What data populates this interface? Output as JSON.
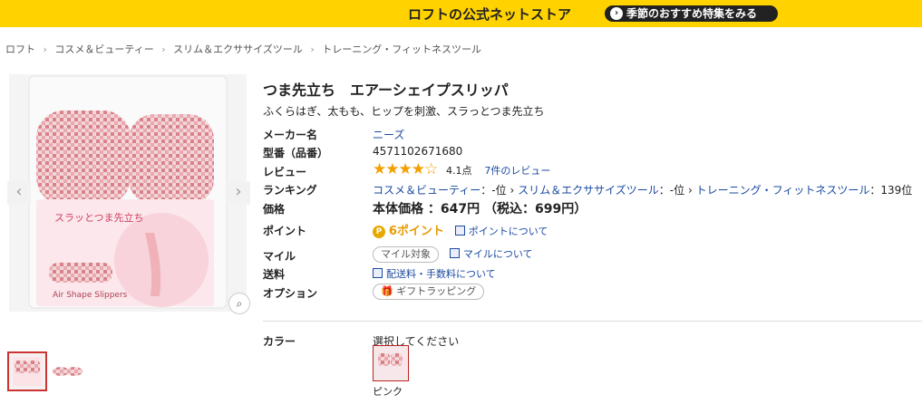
{
  "banner": {
    "title": "ロフトの公式ネットストア",
    "button_label": "季節のおすすめ特集をみる"
  },
  "breadcrumbs": [
    "ロフト",
    "コスメ＆ビューティー",
    "スリム＆エクササイズツール",
    "トレーニング・フィットネスツール"
  ],
  "product": {
    "title": "つま先立ち　エアーシェイプスリッパ",
    "catchcopy": "ふくらはぎ、太もも、ヒップを刺激、スラっとつま先立ち",
    "image_text": {
      "slogan": "スラッとつま先立ち",
      "name": "Air Shape Slippers"
    }
  },
  "specs": {
    "maker_label": "メーカー名",
    "maker_value": "ニーズ",
    "model_label": "型番（品番）",
    "model_value": "4571102671680",
    "review_label": "レビュー",
    "review_rating": 4.1,
    "review_score_text": "4.1点",
    "review_count_text": "7件のレビュー",
    "ranking_label": "ランキング",
    "ranking": [
      {
        "category": "コスメ＆ビューティー",
        "rank": "-位"
      },
      {
        "category": "スリム＆エクササイズツール",
        "rank": "-位"
      },
      {
        "category": "トレーニング・フィットネスツール",
        "rank": "139位"
      }
    ],
    "ranking_sep": "›",
    "price_label": "価格",
    "price_text": "本体価格 ：647円 （税込：699円）",
    "point_label": "ポイント",
    "point_icon": "P",
    "point_value": "6ポイント",
    "point_link": "ポイントについて",
    "mile_label": "マイル",
    "mile_badge": "マイル対象",
    "mile_link": "マイルについて",
    "shipping_label": "送料",
    "shipping_link": "配送料・手数料について",
    "option_label": "オプション",
    "option_badge": "ギフトラッピング"
  },
  "color": {
    "label": "カラー",
    "prompt": "選択してください",
    "options": [
      "ピンク"
    ]
  },
  "colors": {
    "accent": "#ffd200",
    "link": "#1a4aa0",
    "point": "#e7a800"
  }
}
